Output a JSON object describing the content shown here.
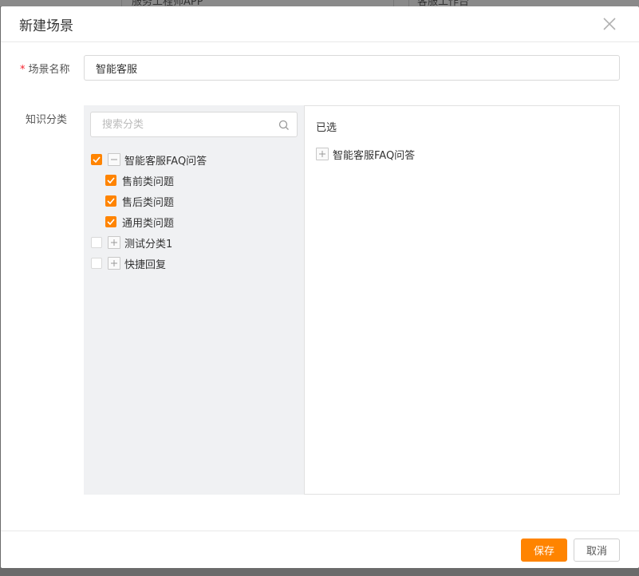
{
  "background": {
    "tab_left": "服务工程师APP",
    "tab_right": "客服工作台"
  },
  "dialog": {
    "title": "新建场景",
    "close_icon": "close-icon"
  },
  "form": {
    "name_required_mark": "*",
    "name_label": "场景名称",
    "name_value": "智能客服",
    "category_label": "知识分类"
  },
  "tree": {
    "search_placeholder": "搜索分类",
    "nodes": [
      {
        "label": "智能客服FAQ问答",
        "checked": true,
        "expanded": true,
        "children": [
          {
            "label": "售前类问题",
            "checked": true
          },
          {
            "label": "售后类问题",
            "checked": true
          },
          {
            "label": "通用类问题",
            "checked": true
          }
        ]
      },
      {
        "label": "测试分类1",
        "checked": false,
        "expanded": false
      },
      {
        "label": "快捷回复",
        "checked": false,
        "expanded": false
      }
    ]
  },
  "selected": {
    "title": "已选",
    "items": [
      {
        "label": "智能客服FAQ问答",
        "expanded": false
      }
    ]
  },
  "footer": {
    "save_label": "保存",
    "cancel_label": "取消"
  },
  "colors": {
    "accent": "#ff8400",
    "required": "#f5222d",
    "tree_bg": "#f0f1f3"
  }
}
